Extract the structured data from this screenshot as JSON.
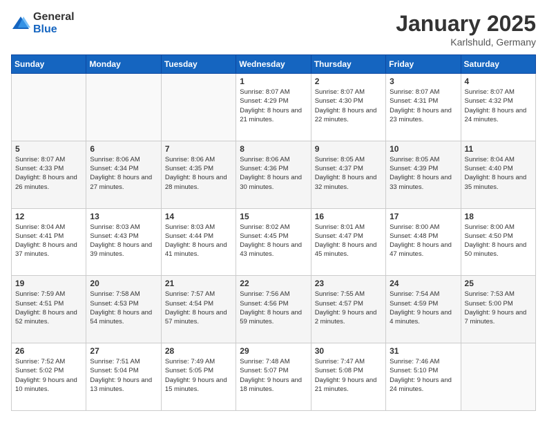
{
  "logo": {
    "general": "General",
    "blue": "Blue"
  },
  "title": "January 2025",
  "subtitle": "Karlshuld, Germany",
  "days": [
    "Sunday",
    "Monday",
    "Tuesday",
    "Wednesday",
    "Thursday",
    "Friday",
    "Saturday"
  ],
  "weeks": [
    [
      {
        "num": "",
        "info": ""
      },
      {
        "num": "",
        "info": ""
      },
      {
        "num": "",
        "info": ""
      },
      {
        "num": "1",
        "info": "Sunrise: 8:07 AM\nSunset: 4:29 PM\nDaylight: 8 hours and 21 minutes."
      },
      {
        "num": "2",
        "info": "Sunrise: 8:07 AM\nSunset: 4:30 PM\nDaylight: 8 hours and 22 minutes."
      },
      {
        "num": "3",
        "info": "Sunrise: 8:07 AM\nSunset: 4:31 PM\nDaylight: 8 hours and 23 minutes."
      },
      {
        "num": "4",
        "info": "Sunrise: 8:07 AM\nSunset: 4:32 PM\nDaylight: 8 hours and 24 minutes."
      }
    ],
    [
      {
        "num": "5",
        "info": "Sunrise: 8:07 AM\nSunset: 4:33 PM\nDaylight: 8 hours and 26 minutes."
      },
      {
        "num": "6",
        "info": "Sunrise: 8:06 AM\nSunset: 4:34 PM\nDaylight: 8 hours and 27 minutes."
      },
      {
        "num": "7",
        "info": "Sunrise: 8:06 AM\nSunset: 4:35 PM\nDaylight: 8 hours and 28 minutes."
      },
      {
        "num": "8",
        "info": "Sunrise: 8:06 AM\nSunset: 4:36 PM\nDaylight: 8 hours and 30 minutes."
      },
      {
        "num": "9",
        "info": "Sunrise: 8:05 AM\nSunset: 4:37 PM\nDaylight: 8 hours and 32 minutes."
      },
      {
        "num": "10",
        "info": "Sunrise: 8:05 AM\nSunset: 4:39 PM\nDaylight: 8 hours and 33 minutes."
      },
      {
        "num": "11",
        "info": "Sunrise: 8:04 AM\nSunset: 4:40 PM\nDaylight: 8 hours and 35 minutes."
      }
    ],
    [
      {
        "num": "12",
        "info": "Sunrise: 8:04 AM\nSunset: 4:41 PM\nDaylight: 8 hours and 37 minutes."
      },
      {
        "num": "13",
        "info": "Sunrise: 8:03 AM\nSunset: 4:43 PM\nDaylight: 8 hours and 39 minutes."
      },
      {
        "num": "14",
        "info": "Sunrise: 8:03 AM\nSunset: 4:44 PM\nDaylight: 8 hours and 41 minutes."
      },
      {
        "num": "15",
        "info": "Sunrise: 8:02 AM\nSunset: 4:45 PM\nDaylight: 8 hours and 43 minutes."
      },
      {
        "num": "16",
        "info": "Sunrise: 8:01 AM\nSunset: 4:47 PM\nDaylight: 8 hours and 45 minutes."
      },
      {
        "num": "17",
        "info": "Sunrise: 8:00 AM\nSunset: 4:48 PM\nDaylight: 8 hours and 47 minutes."
      },
      {
        "num": "18",
        "info": "Sunrise: 8:00 AM\nSunset: 4:50 PM\nDaylight: 8 hours and 50 minutes."
      }
    ],
    [
      {
        "num": "19",
        "info": "Sunrise: 7:59 AM\nSunset: 4:51 PM\nDaylight: 8 hours and 52 minutes."
      },
      {
        "num": "20",
        "info": "Sunrise: 7:58 AM\nSunset: 4:53 PM\nDaylight: 8 hours and 54 minutes."
      },
      {
        "num": "21",
        "info": "Sunrise: 7:57 AM\nSunset: 4:54 PM\nDaylight: 8 hours and 57 minutes."
      },
      {
        "num": "22",
        "info": "Sunrise: 7:56 AM\nSunset: 4:56 PM\nDaylight: 8 hours and 59 minutes."
      },
      {
        "num": "23",
        "info": "Sunrise: 7:55 AM\nSunset: 4:57 PM\nDaylight: 9 hours and 2 minutes."
      },
      {
        "num": "24",
        "info": "Sunrise: 7:54 AM\nSunset: 4:59 PM\nDaylight: 9 hours and 4 minutes."
      },
      {
        "num": "25",
        "info": "Sunrise: 7:53 AM\nSunset: 5:00 PM\nDaylight: 9 hours and 7 minutes."
      }
    ],
    [
      {
        "num": "26",
        "info": "Sunrise: 7:52 AM\nSunset: 5:02 PM\nDaylight: 9 hours and 10 minutes."
      },
      {
        "num": "27",
        "info": "Sunrise: 7:51 AM\nSunset: 5:04 PM\nDaylight: 9 hours and 13 minutes."
      },
      {
        "num": "28",
        "info": "Sunrise: 7:49 AM\nSunset: 5:05 PM\nDaylight: 9 hours and 15 minutes."
      },
      {
        "num": "29",
        "info": "Sunrise: 7:48 AM\nSunset: 5:07 PM\nDaylight: 9 hours and 18 minutes."
      },
      {
        "num": "30",
        "info": "Sunrise: 7:47 AM\nSunset: 5:08 PM\nDaylight: 9 hours and 21 minutes."
      },
      {
        "num": "31",
        "info": "Sunrise: 7:46 AM\nSunset: 5:10 PM\nDaylight: 9 hours and 24 minutes."
      },
      {
        "num": "",
        "info": ""
      }
    ]
  ]
}
